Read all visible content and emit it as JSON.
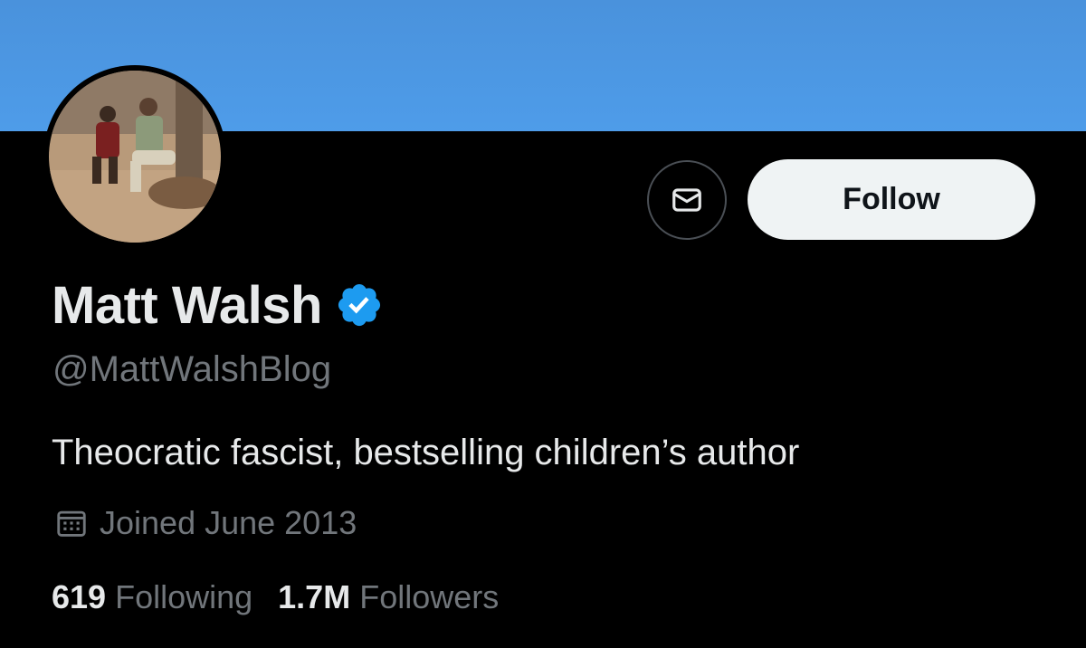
{
  "banner": {
    "color": "#4a97e4"
  },
  "profile": {
    "display_name": "Matt Walsh",
    "handle": "@MattWalshBlog",
    "bio": "Theocratic fascist, bestselling children’s author",
    "joined": "Joined June 2013",
    "verified": true,
    "verified_color": "#1d9bf0"
  },
  "actions": {
    "message_icon": "envelope-icon",
    "follow_label": "Follow"
  },
  "stats": {
    "following_count": "619",
    "following_label": "Following",
    "followers_count": "1.7M",
    "followers_label": "Followers"
  }
}
